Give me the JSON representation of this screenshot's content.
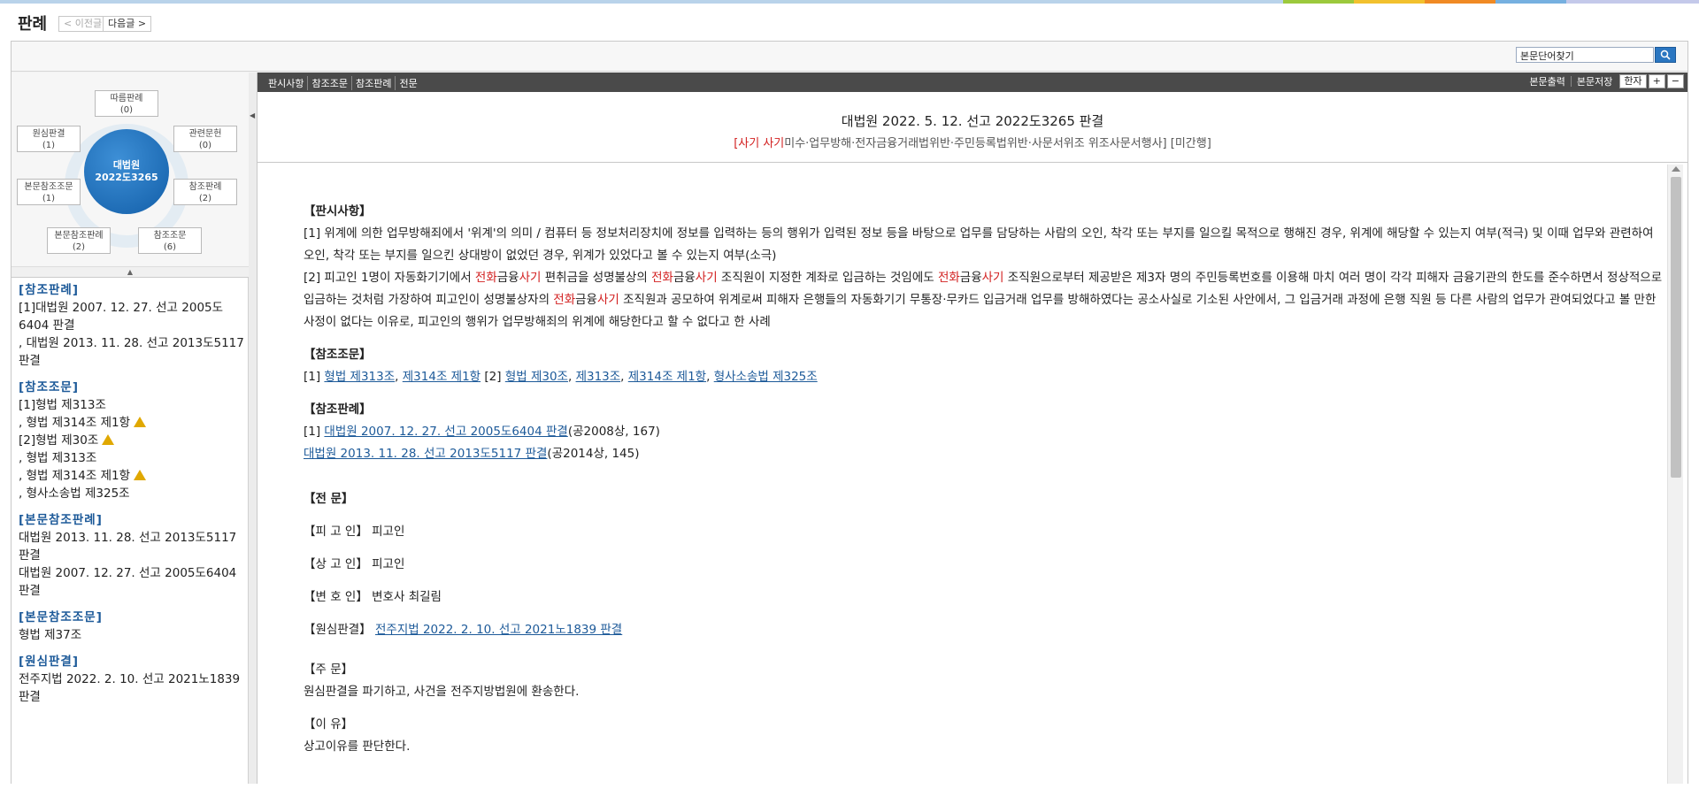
{
  "header": {
    "title": "판례",
    "prev_label": "< 이전글",
    "next_label": "다음글 >"
  },
  "search": {
    "placeholder": "본문단어찾기",
    "button_icon": "search-icon"
  },
  "relmap": {
    "center_line1": "대법원",
    "center_line2": "2022도3265",
    "nodes": [
      {
        "label": "따름판례",
        "count": "(0)"
      },
      {
        "label": "관련문헌",
        "count": "(0)"
      },
      {
        "label": "참조판례",
        "count": "(2)"
      },
      {
        "label": "참조조문",
        "count": "(6)"
      },
      {
        "label": "본문참조판례",
        "count": "(2)"
      },
      {
        "label": "본문참조조문",
        "count": "(1)"
      },
      {
        "label": "원심판결",
        "count": "(1)"
      }
    ]
  },
  "leftlist": {
    "ref_cases_title": "[참조판례]",
    "ref_cases": [
      "[1]대법원 2007. 12. 27. 선고 2005도6404 판결",
      ", 대법원 2013. 11. 28. 선고 2013도5117 판결"
    ],
    "ref_laws_title": "[참조조문]",
    "ref_laws": [
      "[1]형법 제313조",
      ", 형법 제314조 제1항",
      "[2]형법 제30조",
      ", 형법 제313조",
      ", 형법 제314조 제1항",
      ", 형사소송법 제325조"
    ],
    "body_cases_title": "[본문참조판례]",
    "body_cases": [
      "대법원 2013. 11. 28. 선고 2013도5117 판결",
      "대법원 2007. 12. 27. 선고 2005도6404 판결"
    ],
    "body_laws_title": "[본문참조조문]",
    "body_laws": [
      "형법 제37조"
    ],
    "original_title": "[원심판결]",
    "original": [
      "전주지법 2022. 2. 10. 선고 2021노1839 판결"
    ]
  },
  "toolbar": {
    "tabs": [
      "판시사항",
      "참조조문",
      "참조판례",
      "전문"
    ],
    "print": "본문출력",
    "save": "본문저장",
    "hanja": "한자",
    "plus": "+",
    "minus": "−"
  },
  "case": {
    "title": "대법원 2022. 5. 12. 선고 2022도3265 판결",
    "sub_red": "[사기 사기",
    "sub_rest": "미수·업무방해·전자금융거래법위반·주민등록법위반·사문서위조 위조사문서행사] [미간행]"
  },
  "body": {
    "h_holding": "【판시사항】",
    "holding1": "[1] 위계에 의한 업무방해죄에서 '위계'의 의미 / 컴퓨터 등 정보처리장치에 정보를 입력하는 등의 행위가 입력된 정보 등을 바탕으로 업무를 담당하는 사람의 오인, 착각 또는 부지를 일으킬 목적으로 행해진 경우, 위계에 해당할 수 있는지 여부(적극) 및 이때 업무와 관련하여 오인, 착각 또는 부지를 일으킨 상대방이 없었던 경우, 위계가 있었다고 볼 수 있는지 여부(소극)",
    "holding2_a": "[2] 피고인 1명이 자동화기기에서 ",
    "red1": "전화",
    "holding2_b": "금융",
    "red2": "사기",
    "holding2_c": " 편취금을 성명불상의 ",
    "holding2_d": " 조직원이 지정한 계좌로 입금하는 것임에도 ",
    "holding2_e": " 조직원으로부터 제공받은 제3자 명의 주민등록번호를 이용해 마치 여러 명이 각각 피해자 금융기관의 한도를 준수하면서 정상적으로 입금하는 것처럼 가장하여 피고인이 성명불상자의 ",
    "holding2_f": " 조직원과 공모하여 위계로써 피해자 은행들의 자동화기기 무통장·무카드 입금거래 업무를 방해하였다는 공소사실로 기소된 사안에서, 그 입금거래 과정에 은행 직원 등 다른 사람의 업무가 관여되었다고 볼 만한 사정이 없다는 이유로, 피고인의 행위가 업무방해죄의 위계에 해당한다고 할 수 없다고 한 사례",
    "h_laws": "【참조조문】",
    "laws_1": "[1] ",
    "law_a": "형법 제313조",
    "law_b": "제314조 제1항",
    "laws_2": " [2] ",
    "law_c": "형법 제30조",
    "law_d": "제313조",
    "law_e": "제314조 제1항",
    "law_f": "형사소송법 제325조",
    "h_cases": "【참조판례】",
    "case1_pre": "[1] ",
    "case1_link": "대법원 2007. 12. 27. 선고 2005도6404 판결",
    "case1_post": "(공2008상, 167)",
    "case2_link": "대법원 2013. 11. 28. 선고 2013도5117 판결",
    "case2_post": "(공2014상, 145)",
    "h_full": "【전 문】",
    "defendant_label": "【피 고 인】",
    "defendant": "피고인",
    "appellant_label": "【상 고 인】",
    "appellant": "피고인",
    "counsel_label": "【변 호 인】",
    "counsel": "변호사 최길림",
    "original_label": "【원심판결】",
    "original_link": "전주지법 2022. 2. 10. 선고 2021노1839 판결",
    "order_label": "【주 문】",
    "order": "원심판결을 파기하고, 사건을 전주지방법원에 환송한다.",
    "reason_label": "【이 유】",
    "reason": "상고이유를 판단한다."
  },
  "colors": {
    "accent": "#1d5a99",
    "highlight_red": "#d21f1f",
    "toolbar_bg": "#4a4a4a"
  }
}
